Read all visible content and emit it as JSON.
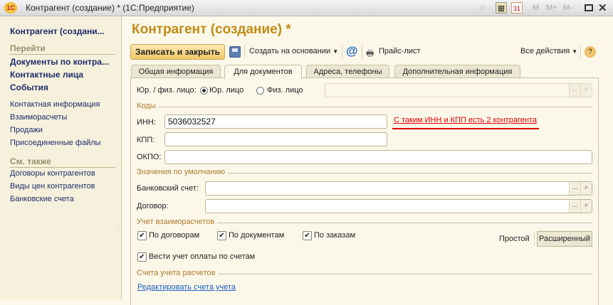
{
  "window": {
    "title": "Контрагент (создание) *  (1С:Предприятие)",
    "logo": "1C",
    "icons": [
      "favorite-icon",
      "calculator-icon",
      "calendar-icon"
    ],
    "calendar_day": "31",
    "mem": [
      "M",
      "M+",
      "M-"
    ]
  },
  "sidebar": {
    "title": "Контрагент (создани...",
    "goto_header": "Перейти",
    "bold_items": [
      "Документы по контра...",
      "Контактные лица",
      "События"
    ],
    "items": [
      "Контактная информация",
      "Взаиморасчеты",
      "Продажи",
      "Присоединенные файлы"
    ],
    "see_also_header": "См. также",
    "see_also": [
      "Договоры контрагентов",
      "Виды цен контрагентов",
      "Банковские счета"
    ]
  },
  "main": {
    "title": "Контрагент (создание) *"
  },
  "toolbar": {
    "save_close": "Записать и закрыть",
    "create_based": "Создать на основании",
    "email": "@",
    "price_list": "Прайс-лист",
    "all_actions": "Все действия",
    "help": "?"
  },
  "tabs": [
    "Общая информация",
    "Для документов",
    "Адреса, телефоны",
    "Дополнительная информация"
  ],
  "active_tab": 1,
  "form": {
    "entity_label": "Юр. / физ. лицо:",
    "legal": "Юр. лицо",
    "individual": "Физ. лицо",
    "selected": "legal",
    "codes_group": "Коды",
    "inn_label": "ИНН:",
    "inn_value": "5036032527",
    "inn_warning": "С таким ИНН и КПП есть 2 контрагента",
    "kpp_label": "КПП:",
    "kpp_value": "",
    "okpo_label": "ОКПО:",
    "okpo_value": "",
    "defaults_group": "Значения по умолчанию",
    "bank_label": "Банковский счет:",
    "bank_value": "",
    "contract_label": "Договор:",
    "contract_value": "",
    "settlements_group": "Учет взаиморасчетов",
    "by_contracts": "По договорам",
    "by_documents": "По документам",
    "by_orders": "По заказам",
    "invoice_payments": "Вести учет оплаты по счетам",
    "mode_simple": "Простой",
    "mode_extended": "Расширенный",
    "accounts_group": "Счета учета расчетов",
    "edit_accounts": "Редактировать счета учета",
    "ellipsis": "...",
    "accent_warning": "#e00000"
  }
}
